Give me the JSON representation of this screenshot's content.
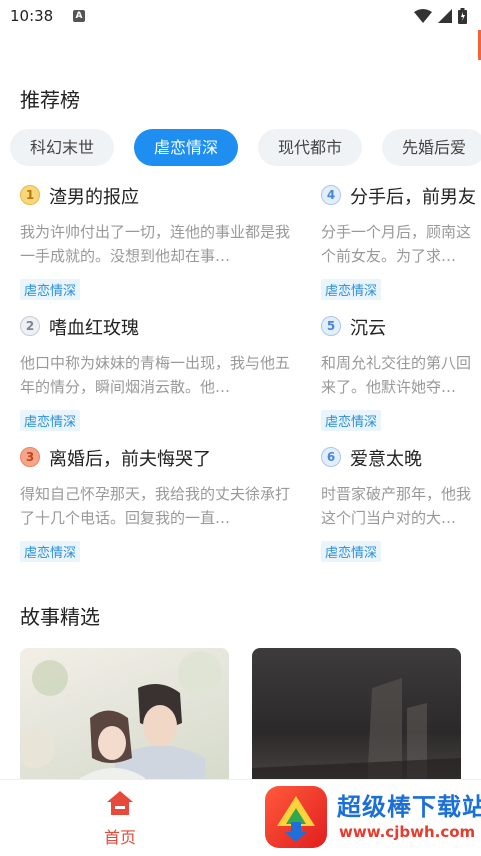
{
  "status": {
    "time": "10:38",
    "notification_glyph": "A"
  },
  "rank": {
    "title": "推荐榜"
  },
  "tabs": [
    {
      "label": "科幻末世",
      "active": false
    },
    {
      "label": "虐恋情深",
      "active": true
    },
    {
      "label": "现代都市",
      "active": false
    },
    {
      "label": "先婚后爱",
      "active": false
    }
  ],
  "items": [
    {
      "num": "1",
      "title": "渣男的报应",
      "desc": "我为许帅付出了一切，连他的事业都是我一手成就的。没想到他却在事…",
      "tag": "虐恋情深"
    },
    {
      "num": "2",
      "title": "嗜血红玫瑰",
      "desc": "他口中称为妹妹的青梅一出现，我与他五年的情分，瞬间烟消云散。他…",
      "tag": "虐恋情深"
    },
    {
      "num": "3",
      "title": "离婚后，前夫悔哭了",
      "desc": "得知自己怀孕那天，我给我的丈夫徐承打了十几个电话。回复我的一直…",
      "tag": "虐恋情深"
    },
    {
      "num": "4",
      "title": "分手后，前男友",
      "desc": "分手一个月后，顾南这个前女友。为了求…",
      "tag": "虐恋情深"
    },
    {
      "num": "5",
      "title": "沉云",
      "desc": "和周允礼交往的第八回来了。他默许她夺…",
      "tag": "虐恋情深"
    },
    {
      "num": "6",
      "title": "爱意太晚",
      "desc": "时晋家破产那年，他我这个门当户对的大…",
      "tag": "虐恋情深"
    }
  ],
  "stories": {
    "title": "故事精选"
  },
  "nav": {
    "home_label": "首页"
  },
  "watermark": {
    "name": "超级棒下载站",
    "url": "www.cjbwh.com"
  },
  "colors": {
    "accent": "#1e8ff0",
    "nav_active": "#e64a3b",
    "tag": "#2a8fd8"
  }
}
